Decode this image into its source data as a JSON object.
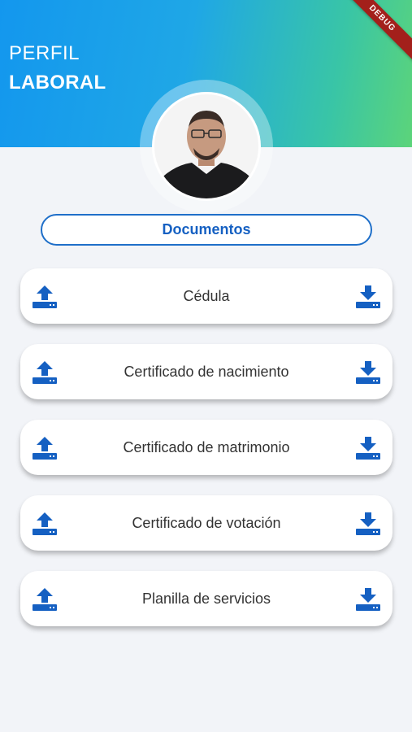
{
  "header": {
    "title_line1": "PERFIL",
    "title_line2": "LABORAL",
    "debug_label": "DEBUG"
  },
  "section": {
    "title": "Documentos"
  },
  "documents": [
    {
      "label": "Cédula"
    },
    {
      "label": "Certificado de nacimiento"
    },
    {
      "label": "Certificado de matrimonio"
    },
    {
      "label": "Certificado de votación"
    },
    {
      "label": "Planilla de servicios"
    }
  ],
  "icons": {
    "upload": "upload-icon",
    "download": "download-icon"
  },
  "colors": {
    "accent": "#1560c2",
    "gradient_start": "#1397ee",
    "gradient_end": "#5cd47a"
  }
}
